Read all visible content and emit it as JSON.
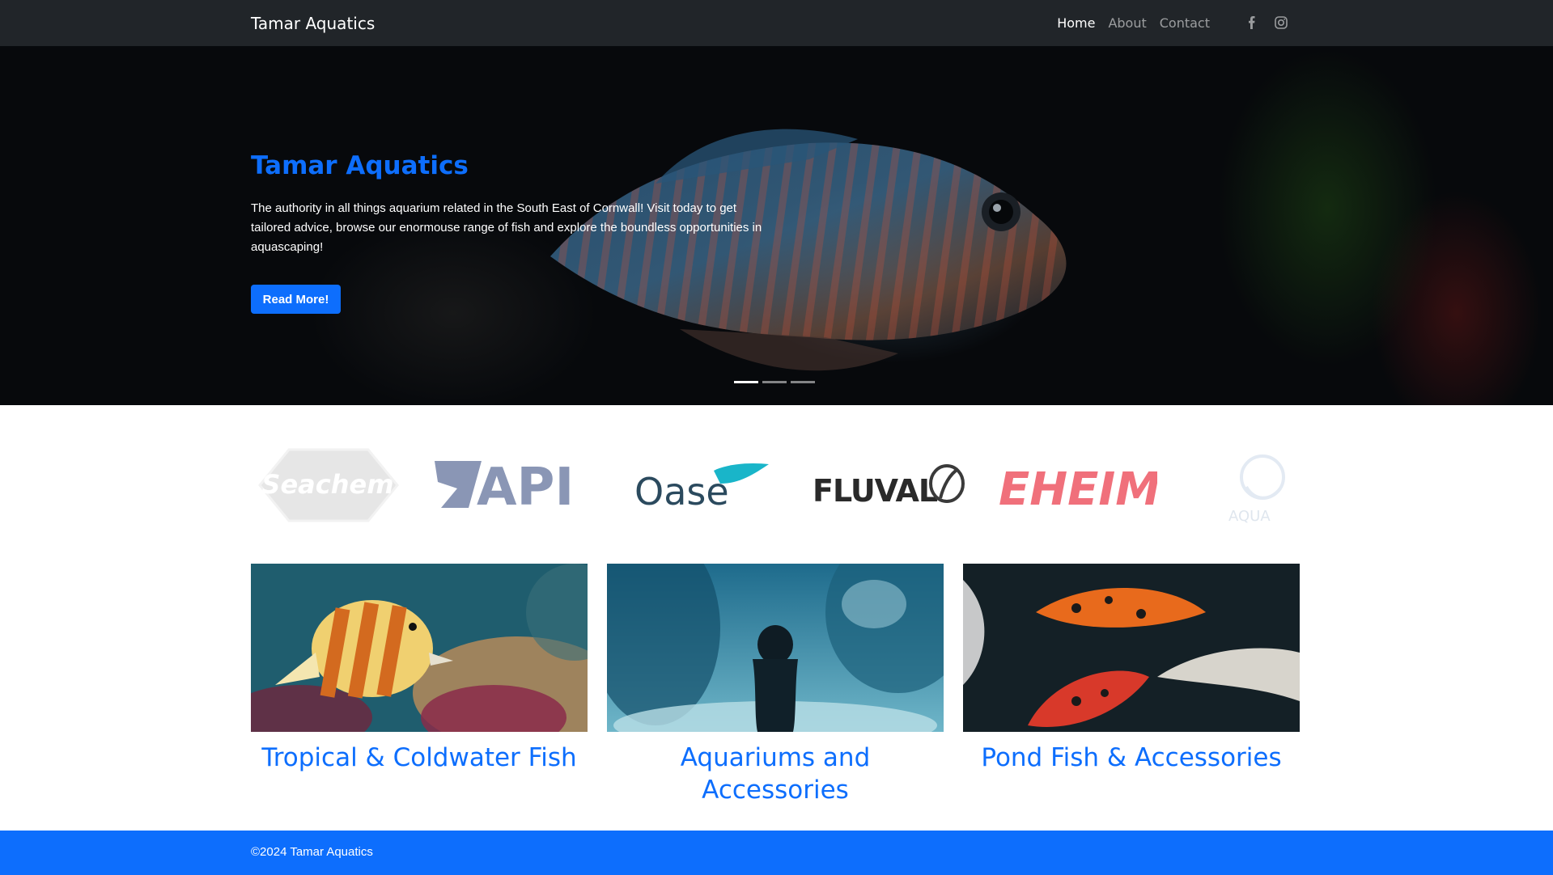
{
  "navbar": {
    "brand": "Tamar Aquatics",
    "links": [
      "Home",
      "About",
      "Contact"
    ],
    "social": [
      "facebook-icon",
      "instagram-icon"
    ]
  },
  "hero": {
    "title": "Tamar Aquatics",
    "text": "The authority in all things aquarium related in the South East of Cornwall! Visit today to get tailored advice, browse our enormouse range of fish and explore the boundless opportunities in aquascaping!",
    "button": "Read More!",
    "slide_count": 3,
    "active_slide": 1
  },
  "brands": [
    "Seachem",
    "API",
    "Oase",
    "FLUVAL",
    "EHEIM",
    "AQUA"
  ],
  "cards": [
    {
      "title": "Tropical & Coldwater Fish"
    },
    {
      "title": "Aquariums and Accessories"
    },
    {
      "title": "Pond Fish & Accessories"
    }
  ],
  "footer": {
    "text": "©2024 Tamar Aquatics"
  },
  "colors": {
    "primary": "#0d6efd",
    "navbar": "#212529",
    "eheim": "#f0707b",
    "oase": "#2b4a5e",
    "oase_accent": "#19b5c9"
  }
}
